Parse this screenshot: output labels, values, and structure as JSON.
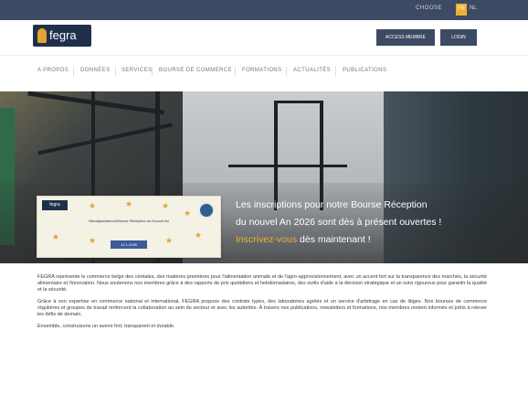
{
  "topbar": {
    "lang_label": "CHOOSE",
    "lang_active": "FR",
    "lang_other": "NL"
  },
  "header": {
    "logo_text": "fegra",
    "members_button": "ACCESS MEMBRE",
    "login_button": "LOGIN"
  },
  "nav": {
    "items": [
      "A PROPOS",
      "DONNÉES",
      "SERVICES",
      "BOURSE DE COMMERCE",
      "FORMATIONS",
      "ACTUALITÉS",
      "PUBLICATIONS"
    ]
  },
  "hero": {
    "text_line1": "Les inscriptions pour notre Bourse Réception",
    "text_line2": "du nouvel An 2026 sont dès à présent ouvertes !",
    "link_text": "Inscrivez-vous",
    "text_line3_rest": " dès maintenant !",
    "banner_logo": "fegra",
    "banner_title": "Nieuwjaarsbeurs/Bourse Réception du Nouvel An",
    "banner_date": "12.1.2026"
  },
  "content": {
    "paragraphs": [
      "FEGRA représente le commerce belge des céréales, des matières premières pour l'alimentation animale et de l'agro-approvisionnement, avec un accent fort sur la transparence des marchés, la sécurité alimentaire et l'innovation. Nous soutenons nos membres grâce à des rapports de prix quotidiens et hebdomadaires, des outils d'aide à la décision stratégique et un suivi rigoureux pour garantir la qualité et la sécurité.",
      "Grâce à son expertise en commerce national et international, FEGRA propose des contrats types, des laboratoires agréés et un service d'arbitrage en cas de litiges. Nos bourses de commerce régulières et groupes de travail renforcent la collaboration au sein du secteur et avec les autorités. À travers nos publications, newsletters et formations, nos membres restent informés et prêts à relever les défis de demain.",
      "Ensemble, construisons un avenir fort, transparent et durable."
    ]
  }
}
